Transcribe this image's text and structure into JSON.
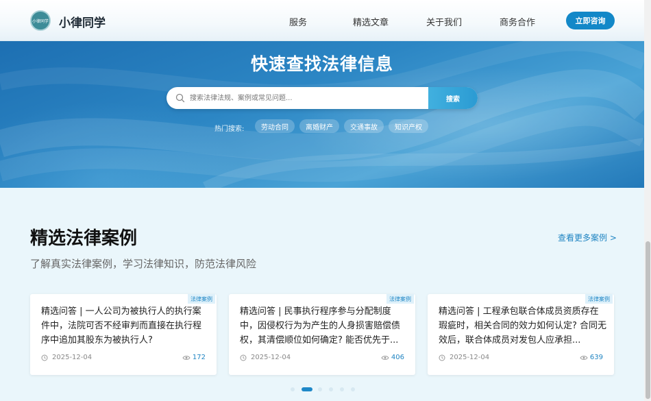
{
  "header": {
    "logo_text": "小律同学",
    "brand": "小律同学",
    "nav": [
      "服务",
      "精选文章",
      "关于我们",
      "商务合作"
    ],
    "cta": "立即咨询"
  },
  "hero": {
    "title": "快速查找法律信息",
    "search": {
      "placeholder": "搜索法律法规、案例或常见问题...",
      "button": "搜索"
    },
    "hot": {
      "label": "热门搜索:",
      "tags": [
        "劳动合同",
        "离婚财产",
        "交通事故",
        "知识产权"
      ]
    }
  },
  "section": {
    "title": "精选法律案例",
    "subtitle": "了解真实法律案例，学习法律知识，防范法律风险",
    "more": "查看更多案例 >",
    "cards": [
      {
        "tag": "法律案例",
        "title": "精选问答 | 一人公司为被执行人的执行案件中，法院可否不经审判而直接在执行程序中追加其股东为被执行人?",
        "date": "2025-12-04",
        "views": "172"
      },
      {
        "tag": "法律案例",
        "title": "精选问答 | 民事执行程序参与分配制度中，因侵权行为为产生的人身损害赔偿债权，其清偿顺位如何确定? 能否优先于...",
        "date": "2025-12-04",
        "views": "406"
      },
      {
        "tag": "法律案例",
        "title": "精选问答 | 工程承包联合体成员资质存在瑕疵时，相关合同的效力如何认定? 合同无效后，联合体成员对发包人应承担...",
        "date": "2025-12-04",
        "views": "639"
      }
    ],
    "pagination": {
      "total": 6,
      "active": 1
    }
  },
  "colors": {
    "accent": "#1388c8",
    "link": "#1f84c2",
    "hero_start": "#1d6fb2",
    "hero_end": "#4aa3d6"
  }
}
